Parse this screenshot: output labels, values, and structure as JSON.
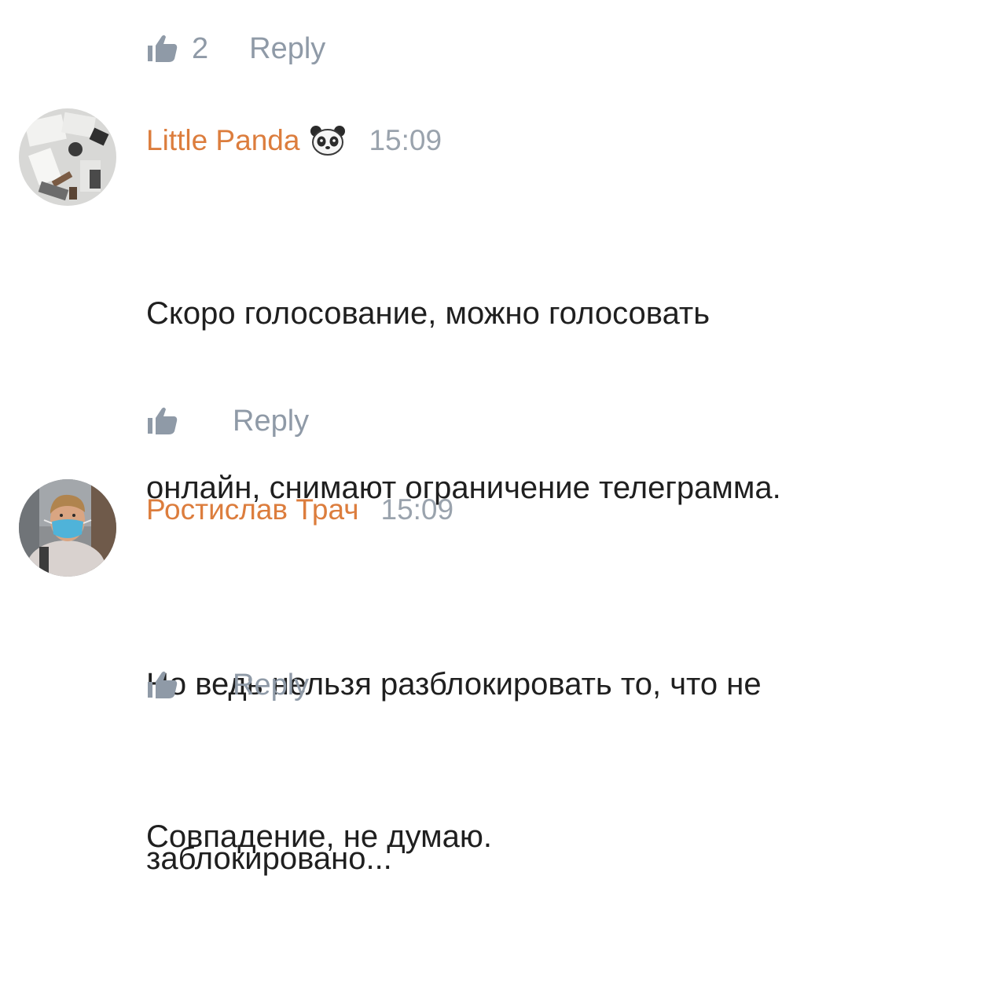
{
  "top_actions": {
    "like_count": "2",
    "reply_label": "Reply"
  },
  "comments": [
    {
      "author": "Little Panda",
      "emoji": "panda-face",
      "time": "15:09",
      "text_line1": "Скоро голосование, можно голосовать",
      "text_line2": "онлайн, снимают ограничение телеграмма.",
      "text_line3": "Совпадение, не думаю.",
      "reply_label": "Reply"
    },
    {
      "author": "Ростислав Трач",
      "time": "15:09",
      "text_line1": "Но ведь нельзя разблокировать то, что не",
      "text_line2": "заблокировано...",
      "reply_label": "Reply"
    }
  ],
  "colors": {
    "author": "#dc7d3d",
    "meta": "#8f9aa7",
    "text": "#1f1f1f"
  }
}
